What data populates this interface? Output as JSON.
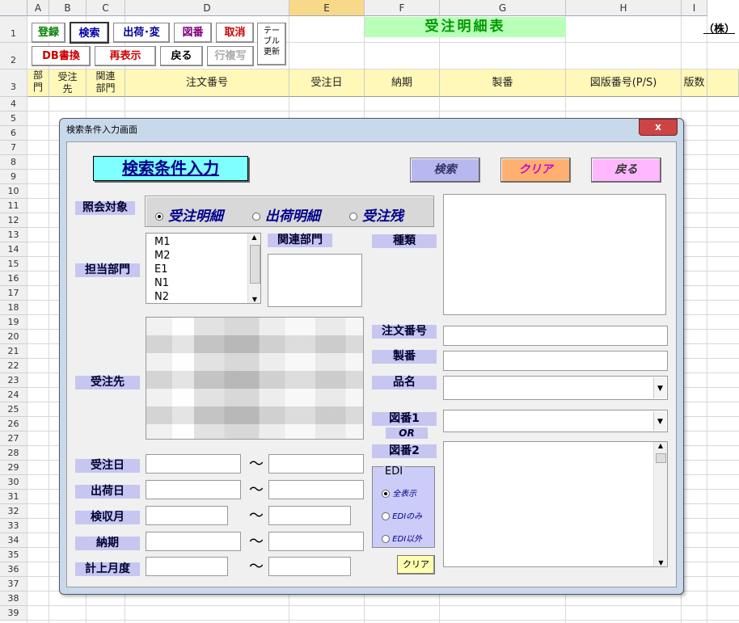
{
  "sheet": {
    "columns": [
      "A",
      "B",
      "C",
      "D",
      "E",
      "F",
      "G",
      "H",
      "I"
    ],
    "selected_column": "E",
    "rows": [
      "1",
      "2",
      "3",
      "4",
      "5",
      "6",
      "7",
      "8",
      "9",
      "10",
      "11",
      "12",
      "13",
      "14",
      "15",
      "16",
      "17",
      "18",
      "19",
      "20",
      "21",
      "22",
      "23",
      "24",
      "25",
      "26",
      "27",
      "28",
      "29",
      "30",
      "31",
      "32",
      "33",
      "34",
      "35",
      "36",
      "37",
      "38",
      "39"
    ],
    "title": "受注明細表",
    "company_partial": "（株）",
    "buttons": {
      "register": "登録",
      "search": "検索",
      "ship_change": "出荷･変",
      "drawing": "図番",
      "cancel": "取消",
      "table_update": "テーブル更新",
      "db_write": "DB書換",
      "redisplay": "再表示",
      "back": "戻る",
      "row_copy": "行複写"
    },
    "headers": {
      "dept": "部門",
      "customer": "受注先",
      "related_dept": "関連部門",
      "order_no": "注文番号",
      "order_date": "受注日",
      "due_date": "納期",
      "product_no": "製番",
      "drawing_no": "図版番号(P/S)",
      "version": "版数"
    }
  },
  "dialog": {
    "title": "検索条件入力画面",
    "close_label": "x",
    "heading": "検索条件入力",
    "search_button": "検索",
    "clear_button": "クリア",
    "back_button": "戻る",
    "target_label": "照会対象",
    "target_options": [
      "受注明細",
      "出荷明細",
      "受注残"
    ],
    "target_selected": "受注明細",
    "dept_label": "担当部門",
    "dept_items": [
      "M1",
      "M2",
      "E1",
      "N1",
      "N2"
    ],
    "related_dept_label": "関連部門",
    "type_label": "種類",
    "customer_label": "受注先",
    "order_no_label": "注文番号",
    "product_no_label": "製番",
    "item_name_label": "品名",
    "drawing1_label": "図番1",
    "or_label": "OR",
    "drawing2_label": "図番2",
    "order_date_label": "受注日",
    "ship_date_label": "出荷日",
    "acceptance_month_label": "検収月",
    "due_label": "納期",
    "booking_month_label": "計上月度",
    "range_sep": "〜",
    "edi_group": "EDI",
    "edi_options": [
      "全表示",
      "EDIのみ",
      "EDI以外"
    ],
    "edi_selected": "全表示",
    "small_clear": "クリア"
  }
}
